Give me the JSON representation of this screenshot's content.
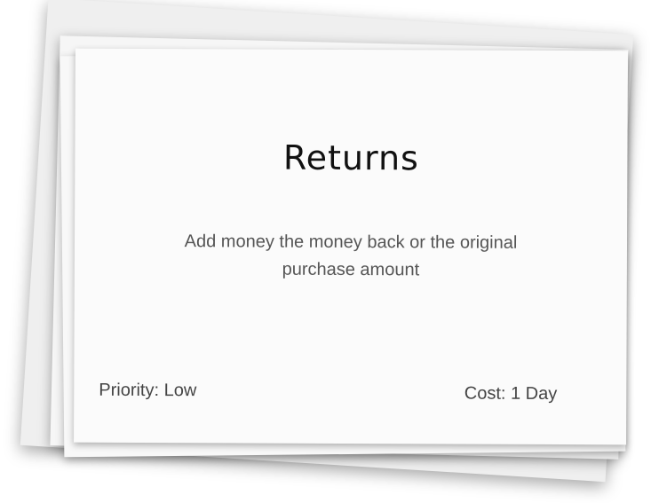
{
  "card": {
    "title": "Returns",
    "description": "Add money the money back or the original purchase amount",
    "priority": "Priority: Low",
    "cost": "Cost: 1 Day"
  },
  "colors": {
    "card_background": "#fbfbfb",
    "title_text": "#111111",
    "body_text": "#555555"
  }
}
